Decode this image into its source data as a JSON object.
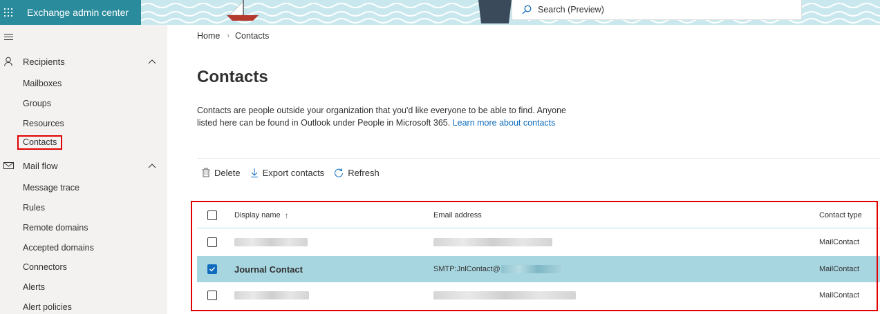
{
  "header": {
    "app_title": "Exchange admin center",
    "search_placeholder": "Search (Preview)",
    "icons": {
      "launcher": "app-launcher-icon",
      "search": "search-icon"
    }
  },
  "sidebar": {
    "groups": [
      {
        "label": "Recipients",
        "icon": "person-icon",
        "expanded": true,
        "items": [
          "Mailboxes",
          "Groups",
          "Resources",
          "Contacts"
        ]
      },
      {
        "label": "Mail flow",
        "icon": "mail-icon",
        "expanded": true,
        "items": [
          "Message trace",
          "Rules",
          "Remote domains",
          "Accepted domains",
          "Connectors",
          "Alerts",
          "Alert policies"
        ]
      }
    ],
    "selected_item": "Contacts"
  },
  "breadcrumb": {
    "home": "Home",
    "current": "Contacts"
  },
  "page": {
    "title": "Contacts",
    "description": "Contacts are people outside your organization that you'd like everyone to be able to find. Anyone listed here can be found in Outlook under People in Microsoft 365.",
    "learn_more": "Learn more about contacts"
  },
  "toolbar": {
    "delete_label": "Delete",
    "export_label": "Export contacts",
    "refresh_label": "Refresh"
  },
  "table": {
    "columns": [
      "Display name",
      "Email address",
      "Contact type"
    ],
    "sort_indicator": "↑",
    "rows": [
      {
        "display_name": "",
        "email": "",
        "contact_type": "MailContact",
        "selected": false,
        "redacted": true
      },
      {
        "display_name": "Journal Contact",
        "email": "SMTP:JnlContact@",
        "contact_type": "MailContact",
        "selected": true,
        "redacted": false
      },
      {
        "display_name": "",
        "email": "",
        "contact_type": "MailContact",
        "selected": false,
        "redacted": true
      }
    ]
  },
  "colors": {
    "brand": "#2a8b9c",
    "selected_row": "#a7d6e1",
    "highlight_border": "#e00000",
    "link": "#0f6cbd"
  }
}
